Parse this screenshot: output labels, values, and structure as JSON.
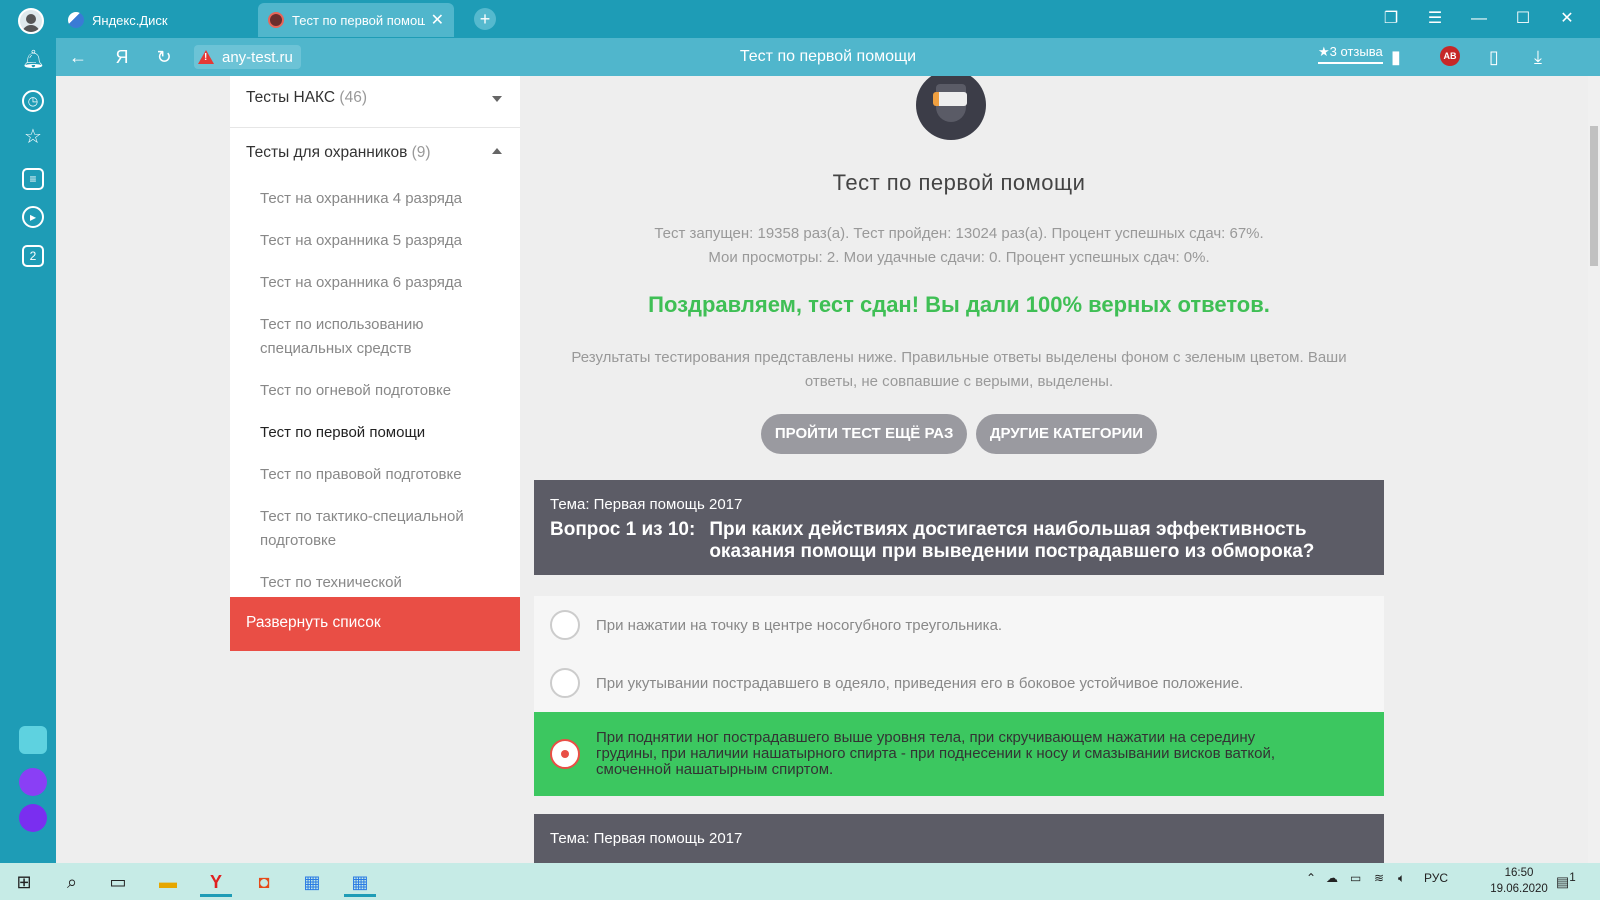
{
  "browser": {
    "tabs": [
      {
        "label": "Яндекс.Диск",
        "active": false
      },
      {
        "label": "Тест по первой помощи",
        "active": true
      }
    ],
    "address": "any-test.ru",
    "page_title": "Тест по первой помощи",
    "reviews": "★3 отзыва",
    "ab_badge": "AB"
  },
  "sidebar": {
    "categories": [
      {
        "label": "Тесты НАКС",
        "count": "(46)",
        "expanded": false
      },
      {
        "label": "Тесты для охранников",
        "count": "(9)",
        "expanded": true
      }
    ],
    "subitems": [
      {
        "label": "Тест на охранника 4 разряда",
        "current": false
      },
      {
        "label": "Тест на охранника 5 разряда",
        "current": false
      },
      {
        "label": "Тест на охранника 6 разряда",
        "current": false
      },
      {
        "label": "Тест по использованию специальных средств",
        "current": false
      },
      {
        "label": "Тест по огневой подготовке",
        "current": false
      },
      {
        "label": "Тест по первой помощи",
        "current": true
      },
      {
        "label": "Тест по правовой подготовке",
        "current": false
      },
      {
        "label": "Тест по тактико-специальной подготовке",
        "current": false
      },
      {
        "label": "Тест по технической",
        "current": false
      }
    ],
    "expand_label": "Развернуть список"
  },
  "main": {
    "title": "Тест по первой помощи",
    "stats_line1": "Тест запущен: 19358 раз(а). Тест пройден: 13024 раз(а). Процент успешных сдач: 67%.",
    "stats_line2": "Мои просмотры: 2. Мои удачные сдачи: 0. Процент успешных сдач: 0%.",
    "congrats": "Поздравляем, тест сдан! Вы дали 100% верных ответов.",
    "results_note": "Результаты тестирования представлены ниже. Правильные ответы выделены фоном с зеленым цветом. Ваши ответы, не совпавшие с верыми, выделены.",
    "retry_button": "ПРОЙТИ ТЕСТ ЕЩЁ РАЗ",
    "other_button": "ДРУГИЕ КАТЕГОРИИ",
    "question": {
      "topic": "Тема: Первая помощь 2017",
      "number": "Вопрос 1 из 10:",
      "text": "При каких действиях достигается наибольшая эффективность оказания помощи при выведении пострадавшего из обморока?",
      "answers": [
        {
          "text": "При нажатии на точку в центре носогубного треугольника.",
          "correct": false
        },
        {
          "text": "При укутывании пострадавшего в одеяло, приведения его в боковое устойчивое положение.",
          "correct": false
        },
        {
          "text": "При поднятии ног пострадавшего выше уровня тела, при скручивающем нажатии на середину грудины, при наличии нашатырного спирта - при поднесении к носу и смазывании висков ваткой, смоченной нашатырным спиртом.",
          "correct": true
        }
      ]
    },
    "next_topic": "Тема: Первая помощь 2017"
  },
  "taskbar": {
    "language": "РУС",
    "time": "16:50",
    "date": "19.06.2020",
    "notifications": "1"
  },
  "colors": {
    "browser_chrome": "#1e9cb6",
    "accent_red": "#e94e45",
    "correct_green": "#3cc760",
    "question_bg": "#5c5c66"
  }
}
